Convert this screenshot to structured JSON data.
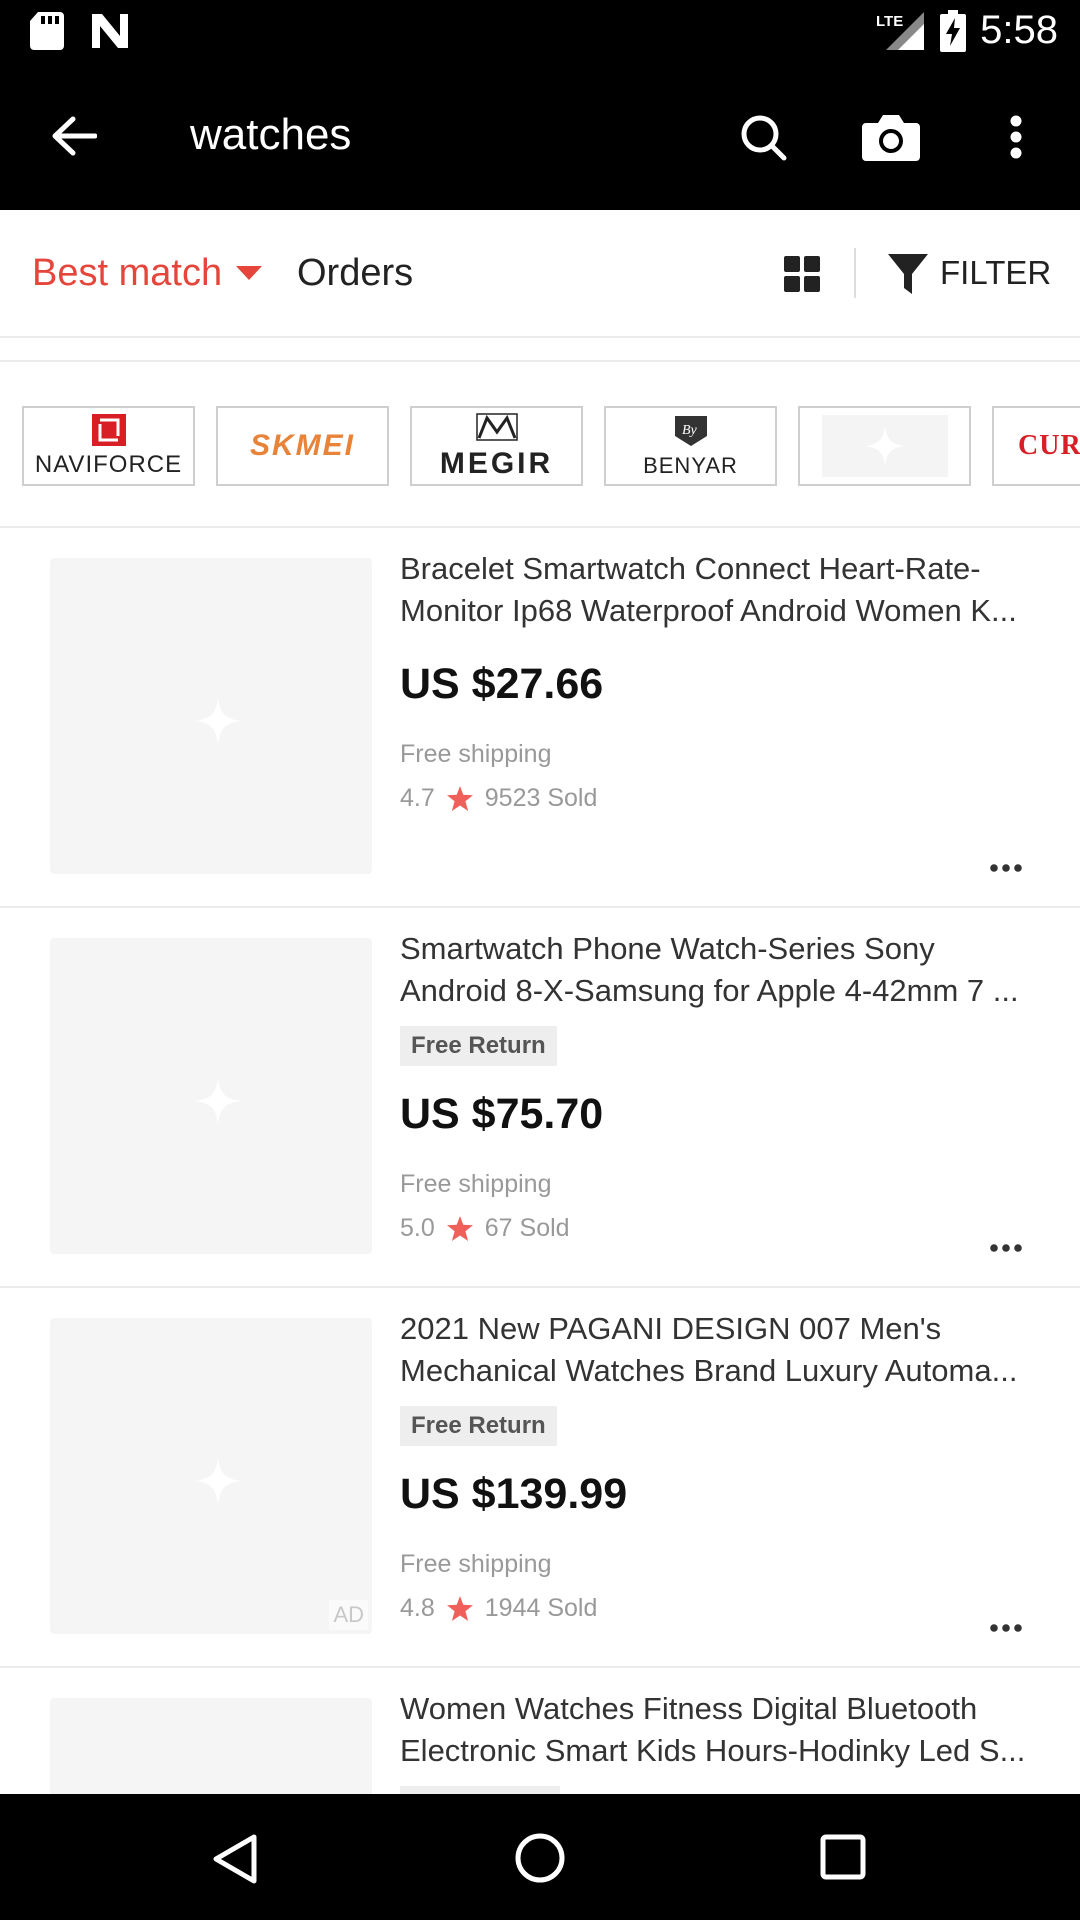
{
  "status_bar": {
    "time": "5:58",
    "network": "LTE",
    "icons": [
      "sd-card-icon",
      "n-notification-icon",
      "lte-signal-icon",
      "battery-charging-icon"
    ]
  },
  "app_bar": {
    "title": "watches",
    "icons": [
      "back-arrow-icon",
      "search-icon",
      "camera-icon",
      "more-vert-icon"
    ]
  },
  "sort_bar": {
    "best_match": "Best match",
    "orders": "Orders",
    "filter": "FILTER"
  },
  "brands": [
    {
      "name": "NAVIFORCE"
    },
    {
      "name": "SKMEI"
    },
    {
      "name": "MEGIR"
    },
    {
      "name": "BENYAR"
    },
    {
      "name": ""
    },
    {
      "name": "CUR"
    }
  ],
  "products": [
    {
      "title_line1": "Bracelet Smartwatch Connect Heart-Rate-",
      "title_line2": "Monitor Ip68 Waterproof Android Women K...",
      "badge": "",
      "price": "US $27.66",
      "shipping": "Free shipping",
      "rating": "4.7",
      "sold": "9523 Sold",
      "ad": ""
    },
    {
      "title_line1": "Smartwatch Phone Watch-Series Sony",
      "title_line2": "Android 8-X-Samsung for Apple 4-42mm 7 ...",
      "badge": "Free Return",
      "price": "US $75.70",
      "shipping": "Free shipping",
      "rating": "5.0",
      "sold": "67 Sold",
      "ad": ""
    },
    {
      "title_line1": "2021 New PAGANI DESIGN 007 Men's",
      "title_line2": "Mechanical Watches Brand Luxury Automa...",
      "badge": "Free Return",
      "price": "US $139.99",
      "shipping": "Free shipping",
      "rating": "4.8",
      "sold": "1944 Sold",
      "ad": "AD"
    },
    {
      "title_line1": "Women Watches Fitness Digital Bluetooth",
      "title_line2": "Electronic Smart Kids Hours-Hodinky Led S...",
      "badge": "",
      "price": "",
      "shipping": "",
      "rating": "",
      "sold": "",
      "ad": ""
    }
  ],
  "colors": {
    "accent": "#e5453b",
    "star": "#f0605a",
    "bar_background": "#000000"
  },
  "nav_bar": {
    "icons": [
      "back-triangle-icon",
      "home-circle-icon",
      "recents-square-icon"
    ]
  }
}
